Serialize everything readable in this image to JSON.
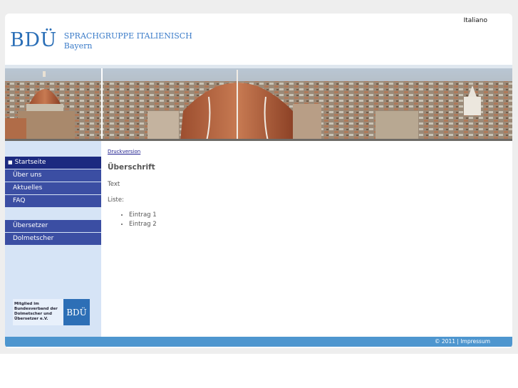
{
  "header": {
    "language_link": "Italiano",
    "logo_mark": "BDÜ",
    "logo_line1": "SPRACHGRUPPE ITALIENISCH",
    "logo_line2": "Bayern"
  },
  "banner": {
    "icon": "florence-cathedral-panorama"
  },
  "nav": {
    "primary": [
      {
        "label": "Startseite",
        "active": true
      },
      {
        "label": "Über uns"
      },
      {
        "label": "Aktuelles"
      },
      {
        "label": "FAQ"
      }
    ],
    "secondary": [
      {
        "label": "Übersetzer"
      },
      {
        "label": "Dolmetscher"
      }
    ]
  },
  "member_badge": {
    "text_lines": [
      "Mitglied im",
      "Bundesverband der",
      "Dolmetscher und",
      "Übersetzer e.V."
    ],
    "logo": "BDÜ"
  },
  "content": {
    "print_link": "Druckversion",
    "heading": "Überschrift",
    "text": "Text",
    "list_label": "Liste:",
    "list_items": [
      "Eintrag 1",
      "Eintrag 2"
    ]
  },
  "footer": {
    "copyright": "© 2011",
    "separator": "|",
    "impressum": "Impressum"
  },
  "colors": {
    "nav_bg": "#3b4ea3",
    "nav_active_bg": "#1c2a80",
    "sidebar_bg": "#d6e4f6",
    "footer_bg": "#4e96cf",
    "logo_blue": "#2b6fb7"
  }
}
